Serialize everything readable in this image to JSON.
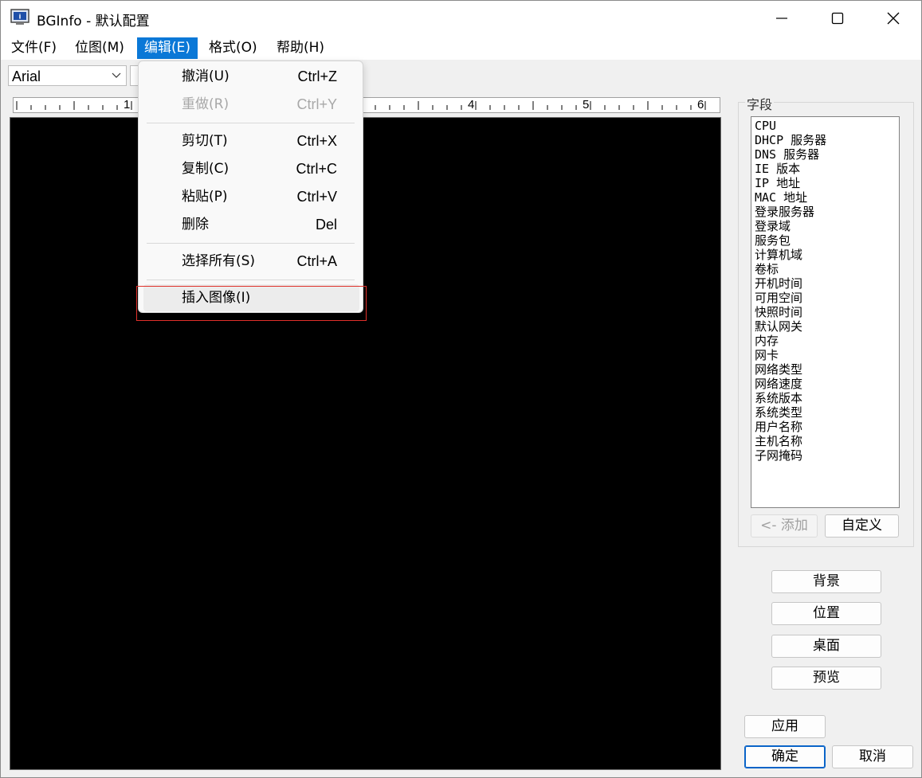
{
  "window": {
    "title": "BGInfo - 默认配置",
    "controls": {
      "minimize": "minimize-icon",
      "maximize": "maximize-icon",
      "close": "close-icon"
    }
  },
  "menubar": {
    "items": [
      {
        "label": "文件(F)"
      },
      {
        "label": "位图(M)"
      },
      {
        "label": "编辑(E)",
        "active": true
      },
      {
        "label": "格式(O)"
      },
      {
        "label": "帮助(H)"
      }
    ]
  },
  "toolbar": {
    "font": "Arial"
  },
  "ruler": {
    "labels": [
      "1",
      "4",
      "5",
      "6"
    ]
  },
  "edit_menu": {
    "items": [
      {
        "label": "撤消(U)",
        "shortcut": "Ctrl+Z",
        "enabled": true
      },
      {
        "label": "重做(R)",
        "shortcut": "Ctrl+Y",
        "enabled": false
      },
      {
        "label": "剪切(T)",
        "shortcut": "Ctrl+X",
        "enabled": true
      },
      {
        "label": "复制(C)",
        "shortcut": "Ctrl+C",
        "enabled": true
      },
      {
        "label": "粘贴(P)",
        "shortcut": "Ctrl+V",
        "enabled": true
      },
      {
        "label": "删除",
        "shortcut": "Del",
        "enabled": true
      },
      {
        "label": "选择所有(S)",
        "shortcut": "Ctrl+A",
        "enabled": true
      },
      {
        "label": "插入图像(I)",
        "shortcut": "",
        "enabled": true,
        "hovered": true
      }
    ]
  },
  "fields": {
    "caption": "字段",
    "items": [
      "CPU",
      "DHCP 服务器",
      "DNS 服务器",
      "IE 版本",
      "IP 地址",
      "MAC 地址",
      "登录服务器",
      "登录域",
      "服务包",
      "计算机域",
      "卷标",
      "开机时间",
      "可用空间",
      "快照时间",
      "默认网关",
      "内存",
      "网卡",
      "网络类型",
      "网络速度",
      "系统版本",
      "系统类型",
      "用户名称",
      "主机名称",
      "子网掩码"
    ],
    "add_label": "<- 添加",
    "custom_label": "自定义"
  },
  "side_buttons": {
    "background": "背景",
    "position": "位置",
    "desktop": "桌面",
    "preview": "预览"
  },
  "footer_buttons": {
    "apply": "应用",
    "ok": "确定",
    "cancel": "取消"
  },
  "colors": {
    "accent": "#0a78d7",
    "editor_bg": "#000000",
    "highlight": "#e0302a"
  }
}
